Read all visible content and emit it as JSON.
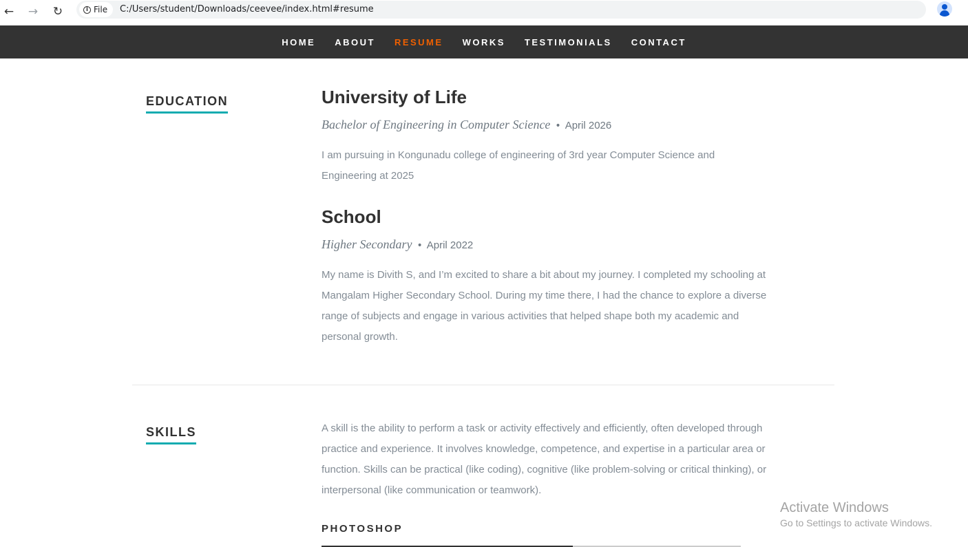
{
  "browser": {
    "back_icon": "←",
    "forward_icon": "→",
    "reload_icon": "↻",
    "chip_label": "File",
    "url": "C:/Users/student/Downloads/ceevee/index.html#resume",
    "star_icon": "☆"
  },
  "nav": {
    "items": [
      "HOME",
      "ABOUT",
      "RESUME",
      "WORKS",
      "TESTIMONIALS",
      "CONTACT"
    ],
    "active": "RESUME",
    "active_color": "#f06000",
    "bar_color": "#333333"
  },
  "education": {
    "heading": "EDUCATION",
    "entries": [
      {
        "title": "University of Life",
        "degree": "Bachelor of Engineering in Computer Science",
        "date": "April 2026",
        "description": "I am pursuing in Kongunadu college of engineering of 3rd year Computer Science and Engineering at 2025"
      },
      {
        "title": "School",
        "degree": "Higher Secondary",
        "date": "April 2022",
        "description": "My name is Divith S, and I’m excited to share a bit about my journey. I completed my schooling at Mangalam Higher Secondary School. During my time there, I had the chance to explore a diverse range of subjects and engage in various activities that helped shape both my academic and personal growth."
      }
    ]
  },
  "skills": {
    "heading": "SKILLS",
    "intro": "A skill is the ability to perform a task or activity effectively and efficiently, often developed through practice and experience. It involves knowledge, competence, and expertise in a particular area or function. Skills can be practical (like coding), cognitive (like problem-solving or critical thinking), or interpersonal (like communication or teamwork).",
    "items": [
      {
        "name": "PHOTOSHOP",
        "level_percent": 60
      }
    ]
  },
  "accent_color": "#11abb0",
  "bullet": "•",
  "watermark": {
    "line1": "Activate Windows",
    "line2": "Go to Settings to activate Windows."
  }
}
